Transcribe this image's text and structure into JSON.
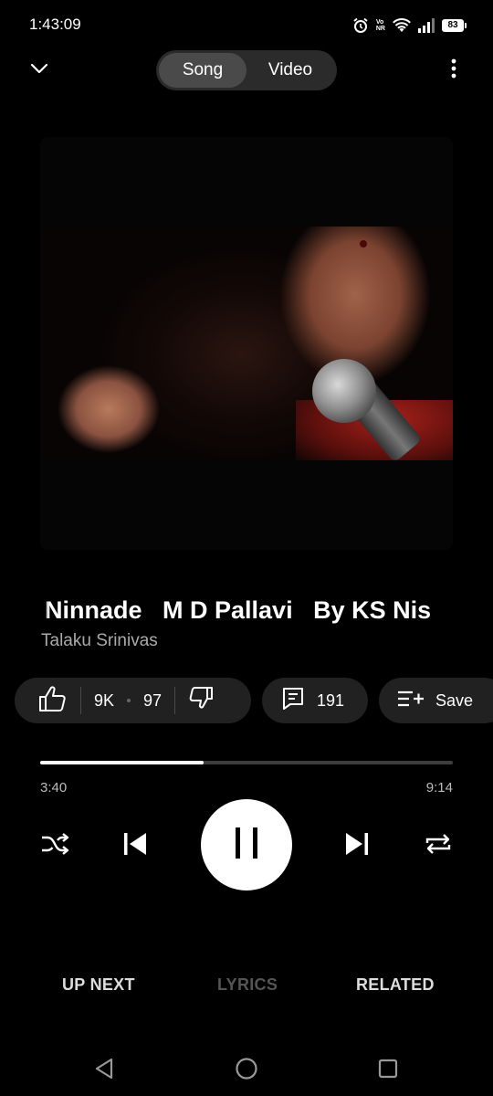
{
  "status_bar": {
    "time": "1:43:09",
    "network_label": "Vo\nNR",
    "battery": "83",
    "icons": [
      "alarm-icon",
      "volte-icon",
      "wifi-icon",
      "signal-icon",
      "battery-icon"
    ]
  },
  "header": {
    "collapse_icon": "chevron-down-icon",
    "toggle": {
      "options": [
        "Song",
        "Video"
      ],
      "selected": "Song"
    },
    "more_icon": "more-vertical-icon"
  },
  "track": {
    "title": "Ninnade   M D Pallavi   By KS Nis",
    "artist": "Talaku Srinivas"
  },
  "actions": {
    "likes": "9K",
    "dislikes": "97",
    "comments": "191",
    "save_label": "Save"
  },
  "playback": {
    "current_time": "3:40",
    "total_time": "9:14",
    "progress": 0.397,
    "state": "playing"
  },
  "controls": [
    "shuffle-icon",
    "previous-icon",
    "pause-icon",
    "next-icon",
    "repeat-icon"
  ],
  "tabs": {
    "up_next": "UP NEXT",
    "lyrics": "LYRICS",
    "related": "RELATED",
    "disabled": [
      "LYRICS"
    ]
  },
  "colors": {
    "background": "#000000",
    "pill": "#212121",
    "toggle_active": "#4a4a4a",
    "secondary_text": "#aaaaaa",
    "disabled_tab": "#555555"
  }
}
